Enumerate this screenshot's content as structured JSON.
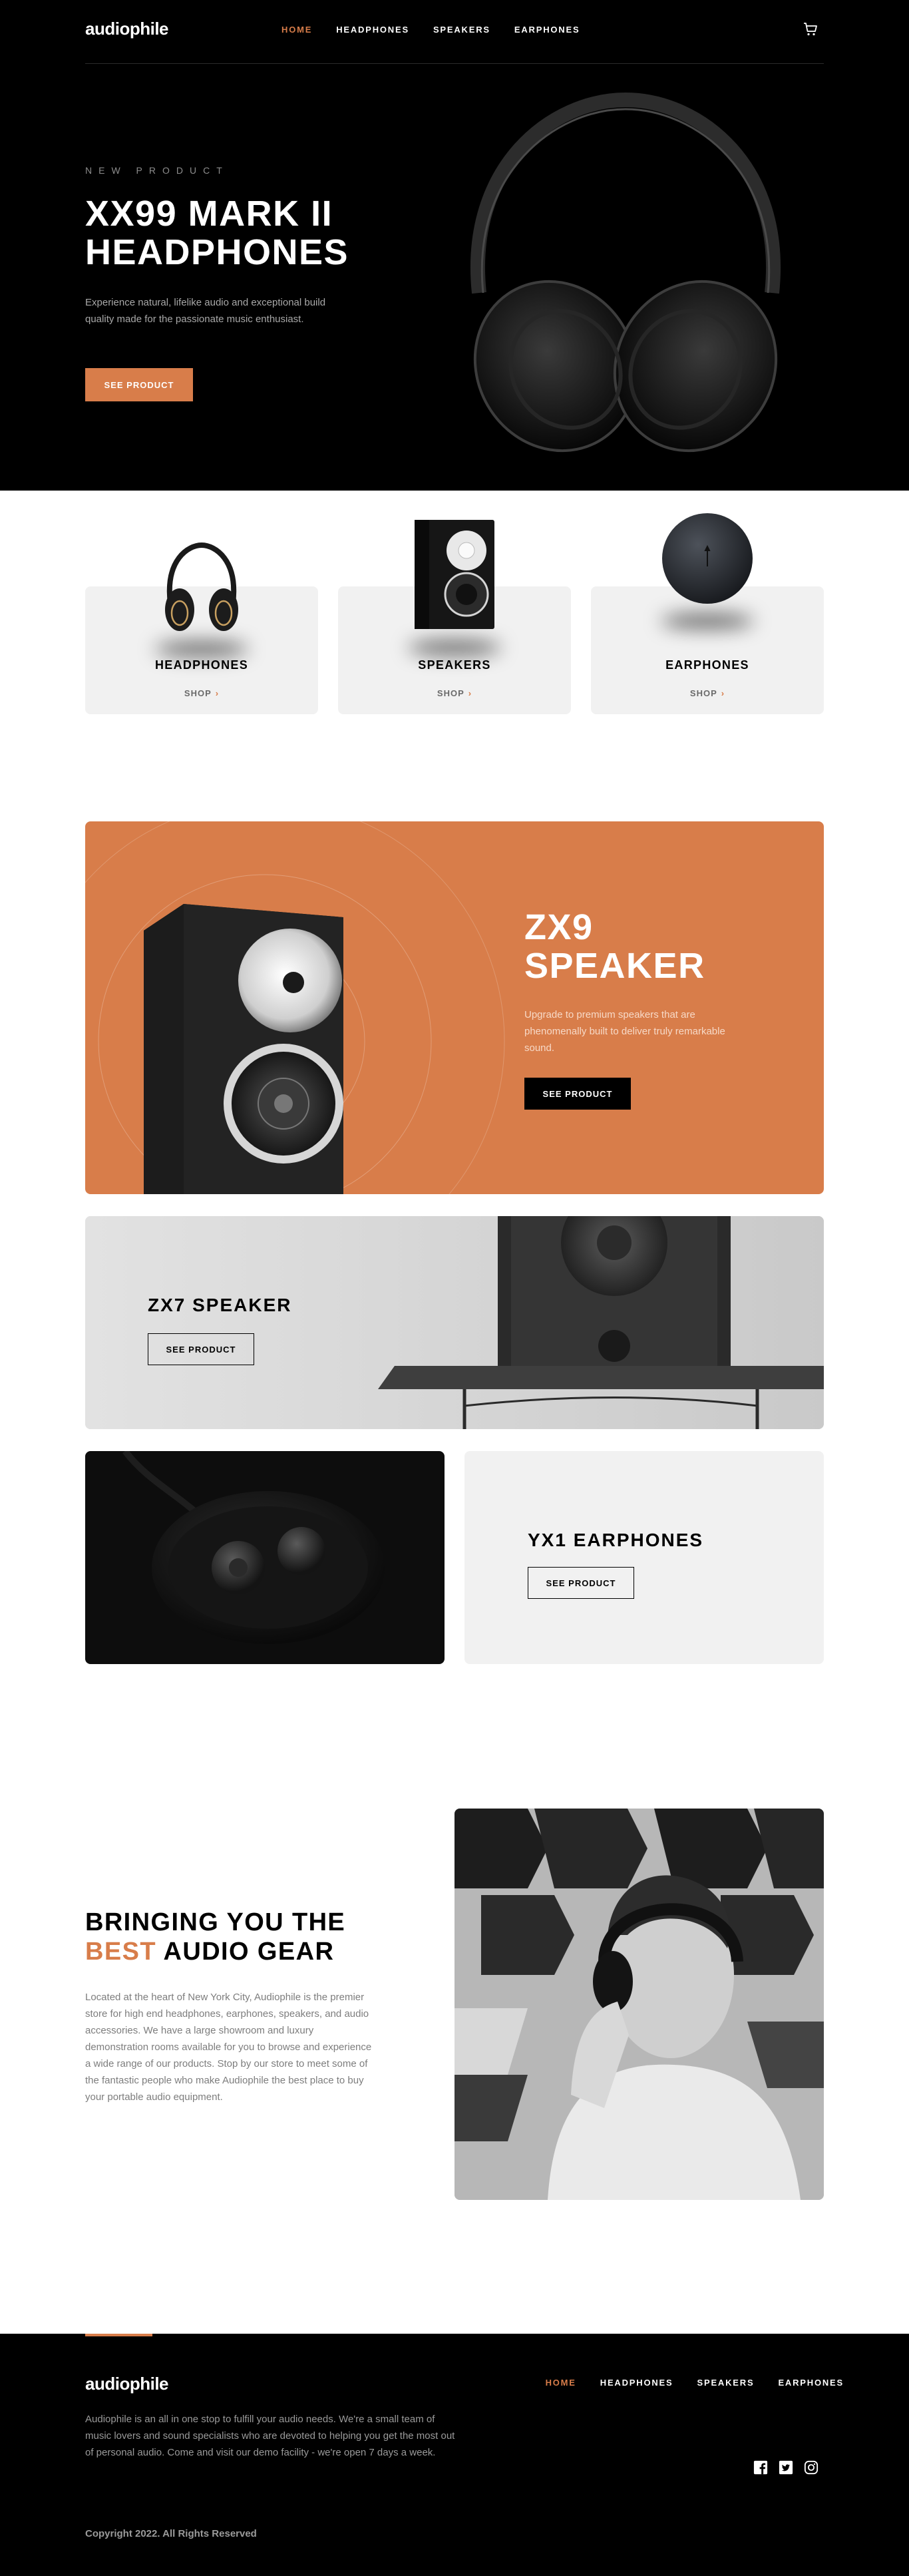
{
  "nav": {
    "logo": "audiophile",
    "links": [
      "HOME",
      "HEADPHONES",
      "SPEAKERS",
      "EARPHONES"
    ],
    "active": 0,
    "cart_icon": "cart-icon"
  },
  "hero": {
    "eyebrow": "NEW PRODUCT",
    "title": "XX99 MARK II HEADPHONES",
    "description": "Experience natural, lifelike audio and exceptional build quality made for the passionate music enthusiast.",
    "button": "SEE PRODUCT"
  },
  "categories": [
    {
      "name": "HEADPHONES",
      "shop": "SHOP"
    },
    {
      "name": "SPEAKERS",
      "shop": "SHOP"
    },
    {
      "name": "EARPHONES",
      "shop": "SHOP"
    }
  ],
  "zx9": {
    "title": "ZX9 SPEAKER",
    "description": "Upgrade to premium speakers that are phenomenally built to deliver truly remarkable sound.",
    "button": "SEE PRODUCT"
  },
  "zx7": {
    "title": "ZX7 SPEAKER",
    "button": "SEE PRODUCT"
  },
  "yx1": {
    "title": "YX1 EARPHONES",
    "button": "SEE PRODUCT"
  },
  "about": {
    "title_pre": "BRINGING YOU THE",
    "title_accent": "BEST",
    "title_post": "AUDIO GEAR",
    "description": "Located at the heart of New York City, Audiophile is the premier store for high end headphones, earphones, speakers, and audio accessories. We have a large showroom and luxury demonstration rooms available for you to browse and experience a wide range of our products. Stop by our store to meet some of the fantastic people who make Audiophile the best place to buy your portable audio equipment."
  },
  "footer": {
    "logo": "audiophile",
    "links": [
      "HOME",
      "HEADPHONES",
      "SPEAKERS",
      "EARPHONES"
    ],
    "active": 0,
    "description": "Audiophile is an all in one stop to fulfill your audio needs. We're a small team of music lovers and sound specialists who are devoted to helping you get the most out of personal audio. Come and visit our demo facility - we're open 7 days a week.",
    "socials": [
      "facebook-icon",
      "twitter-icon",
      "instagram-icon"
    ],
    "copyright": "Copyright 2022. All Rights Reserved"
  },
  "colors": {
    "accent": "#D87D4A",
    "dark": "#000000",
    "light_gray": "#F1F1F1"
  }
}
